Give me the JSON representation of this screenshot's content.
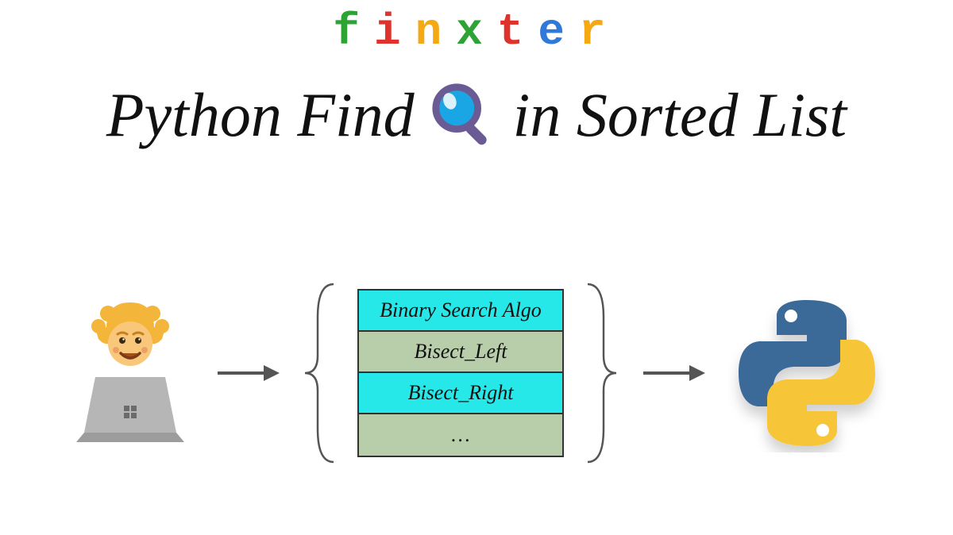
{
  "logo": {
    "letters": [
      {
        "char": "f",
        "color": "#2ea335"
      },
      {
        "char": "i",
        "color": "#e0322d"
      },
      {
        "char": "n",
        "color": "#f4a912"
      },
      {
        "char": "x",
        "color": "#2ea335"
      },
      {
        "char": "t",
        "color": "#e0322d"
      },
      {
        "char": "e",
        "color": "#2f79d8"
      },
      {
        "char": "r",
        "color": "#f4a912"
      }
    ]
  },
  "title": {
    "left": "Python Find",
    "right": "in Sorted List"
  },
  "table": {
    "rows": [
      {
        "label": "Binary Search Algo",
        "style": "cyan"
      },
      {
        "label": "Bisect_Left",
        "style": "green"
      },
      {
        "label": "Bisect_Right",
        "style": "cyan"
      },
      {
        "label": "…",
        "style": "green"
      }
    ]
  },
  "icons": {
    "magnifier": "magnifying-glass-icon",
    "programmer": "programmer-emoji",
    "python": "python-logo",
    "arrow": "arrow-right",
    "brace_left": "curly-brace-left",
    "brace_right": "curly-brace-right"
  },
  "colors": {
    "python_blue": "#3a6a98",
    "python_yellow": "#f6c638",
    "mag_lens": "#1aa6e5",
    "mag_handle": "#6b5b95",
    "hair": "#f3b53a",
    "skin": "#f8c77a",
    "laptop": "#b6b6b6"
  }
}
